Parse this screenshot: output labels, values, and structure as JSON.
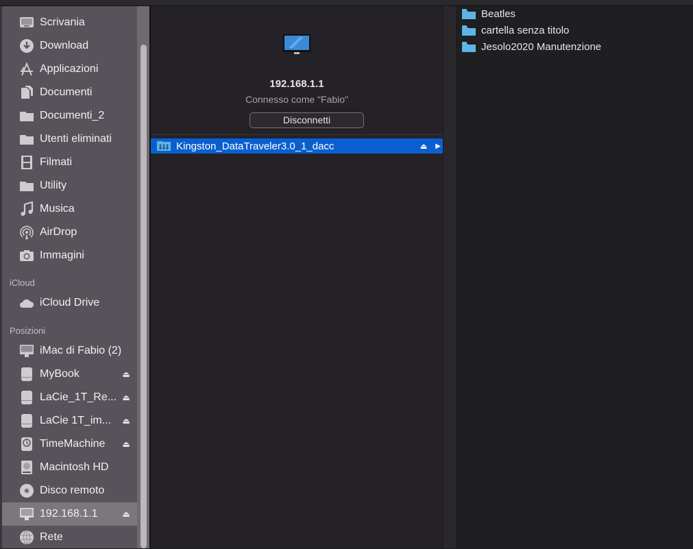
{
  "sidebar": {
    "favorites": [
      {
        "label": "Scrivania",
        "icon": "desktop-icon"
      },
      {
        "label": "Download",
        "icon": "download-icon"
      },
      {
        "label": "Applicazioni",
        "icon": "applications-icon"
      },
      {
        "label": "Documenti",
        "icon": "documents-icon"
      },
      {
        "label": "Documenti_2",
        "icon": "folder-icon"
      },
      {
        "label": "Utenti eliminati",
        "icon": "folder-icon"
      },
      {
        "label": "Filmati",
        "icon": "film-icon"
      },
      {
        "label": "Utility",
        "icon": "folder-icon"
      },
      {
        "label": "Musica",
        "icon": "music-icon"
      },
      {
        "label": "AirDrop",
        "icon": "airdrop-icon"
      },
      {
        "label": "Immagini",
        "icon": "camera-icon"
      }
    ],
    "icloud_header": "iCloud",
    "icloud": [
      {
        "label": "iCloud Drive",
        "icon": "cloud-icon"
      }
    ],
    "locations_header": "Posizioni",
    "locations": [
      {
        "label": "iMac di Fabio (2)",
        "icon": "imac-icon",
        "eject": false
      },
      {
        "label": "MyBook",
        "icon": "disk-icon",
        "eject": true
      },
      {
        "label": "LaCie_1T_Re...",
        "icon": "disk-icon",
        "eject": true
      },
      {
        "label": "LaCie 1T_im...",
        "icon": "disk-icon",
        "eject": true
      },
      {
        "label": "TimeMachine",
        "icon": "timemachine-icon",
        "eject": true
      },
      {
        "label": "Macintosh HD",
        "icon": "harddisk-icon",
        "eject": false
      },
      {
        "label": "Disco remoto",
        "icon": "disc-icon",
        "eject": false
      },
      {
        "label": "192.168.1.1",
        "icon": "monitor-icon",
        "eject": true,
        "selected": true
      },
      {
        "label": "Rete",
        "icon": "network-icon",
        "eject": false
      }
    ]
  },
  "server": {
    "name": "192.168.1.1",
    "status": "Connesso come \"Fabio\"",
    "disconnect_label": "Disconnetti"
  },
  "volume": {
    "label": "Kingston_DataTraveler3.0_1_dacc",
    "icon": "shared-folder-icon"
  },
  "folders": [
    "Beatles",
    "cartella senza titolo",
    "Jesolo2020 Manutenzione"
  ],
  "colors": {
    "selection": "#0a5fd0",
    "sidebar": "#58535a",
    "folder": "#5fb4e6"
  }
}
